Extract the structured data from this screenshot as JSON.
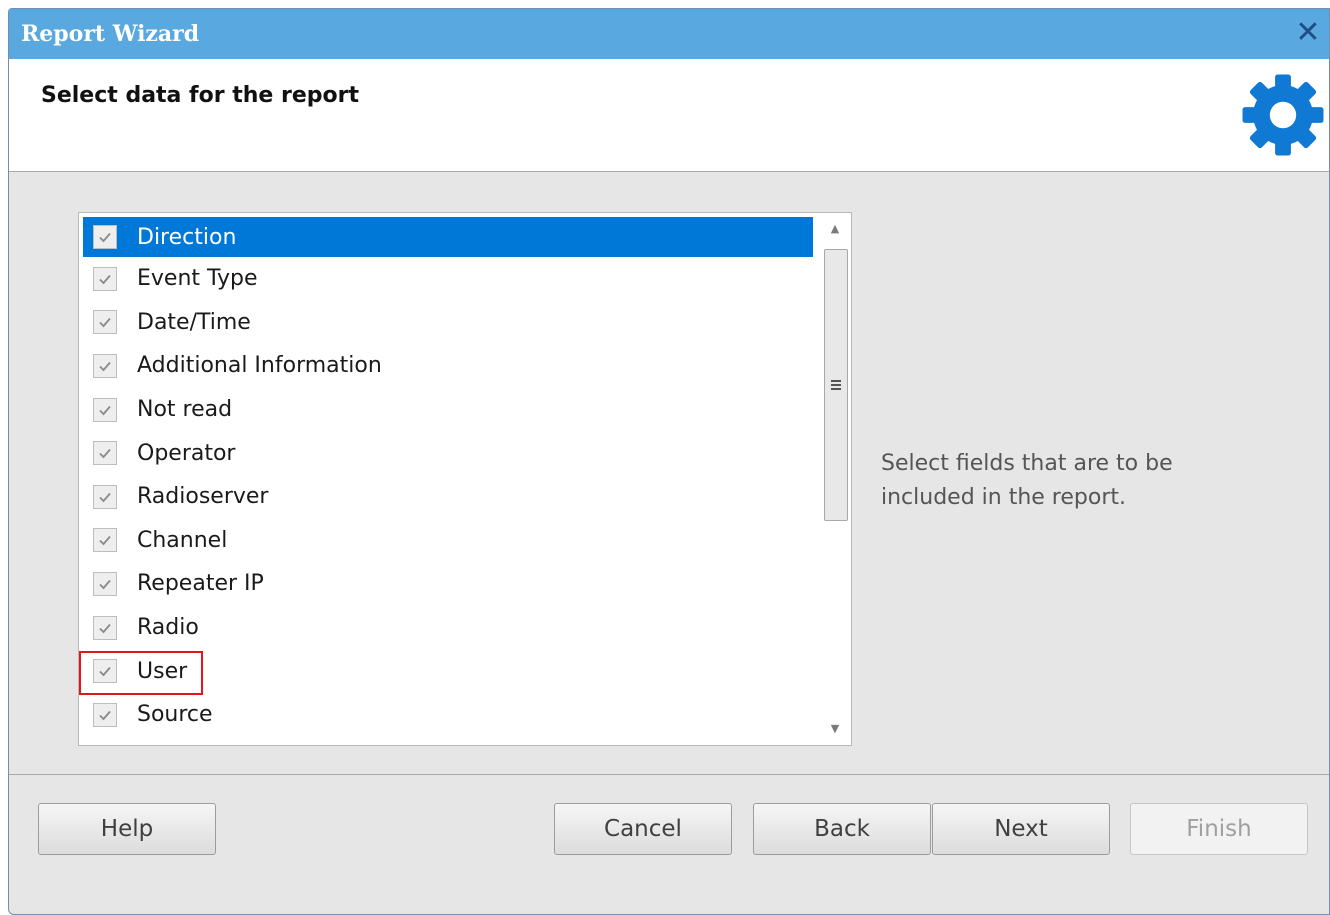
{
  "window": {
    "title": "Report Wizard",
    "close_glyph": "✕"
  },
  "header": {
    "heading": "Select data for the report",
    "icon": "gear-icon"
  },
  "fields": {
    "items": [
      {
        "label": "Direction",
        "checked": true,
        "selected": true
      },
      {
        "label": "Event Type",
        "checked": true
      },
      {
        "label": "Date/Time",
        "checked": true
      },
      {
        "label": "Additional Information",
        "checked": true
      },
      {
        "label": "Not read",
        "checked": true
      },
      {
        "label": "Operator",
        "checked": true
      },
      {
        "label": "Radioserver",
        "checked": true
      },
      {
        "label": "Channel",
        "checked": true
      },
      {
        "label": "Repeater IP",
        "checked": true
      },
      {
        "label": "Radio",
        "checked": true
      },
      {
        "label": "User",
        "checked": true,
        "highlighted": true
      },
      {
        "label": "Source",
        "checked": true
      }
    ]
  },
  "hint": "Select fields that are to be included in the report.",
  "buttons": {
    "help": "Help",
    "cancel": "Cancel",
    "back": "Back",
    "next": "Next",
    "finish": "Finish"
  },
  "colors": {
    "titlebar": "#5aa8e0",
    "selection": "#0078d7",
    "gear": "#0f79d4",
    "highlight_box": "#e3161b"
  }
}
